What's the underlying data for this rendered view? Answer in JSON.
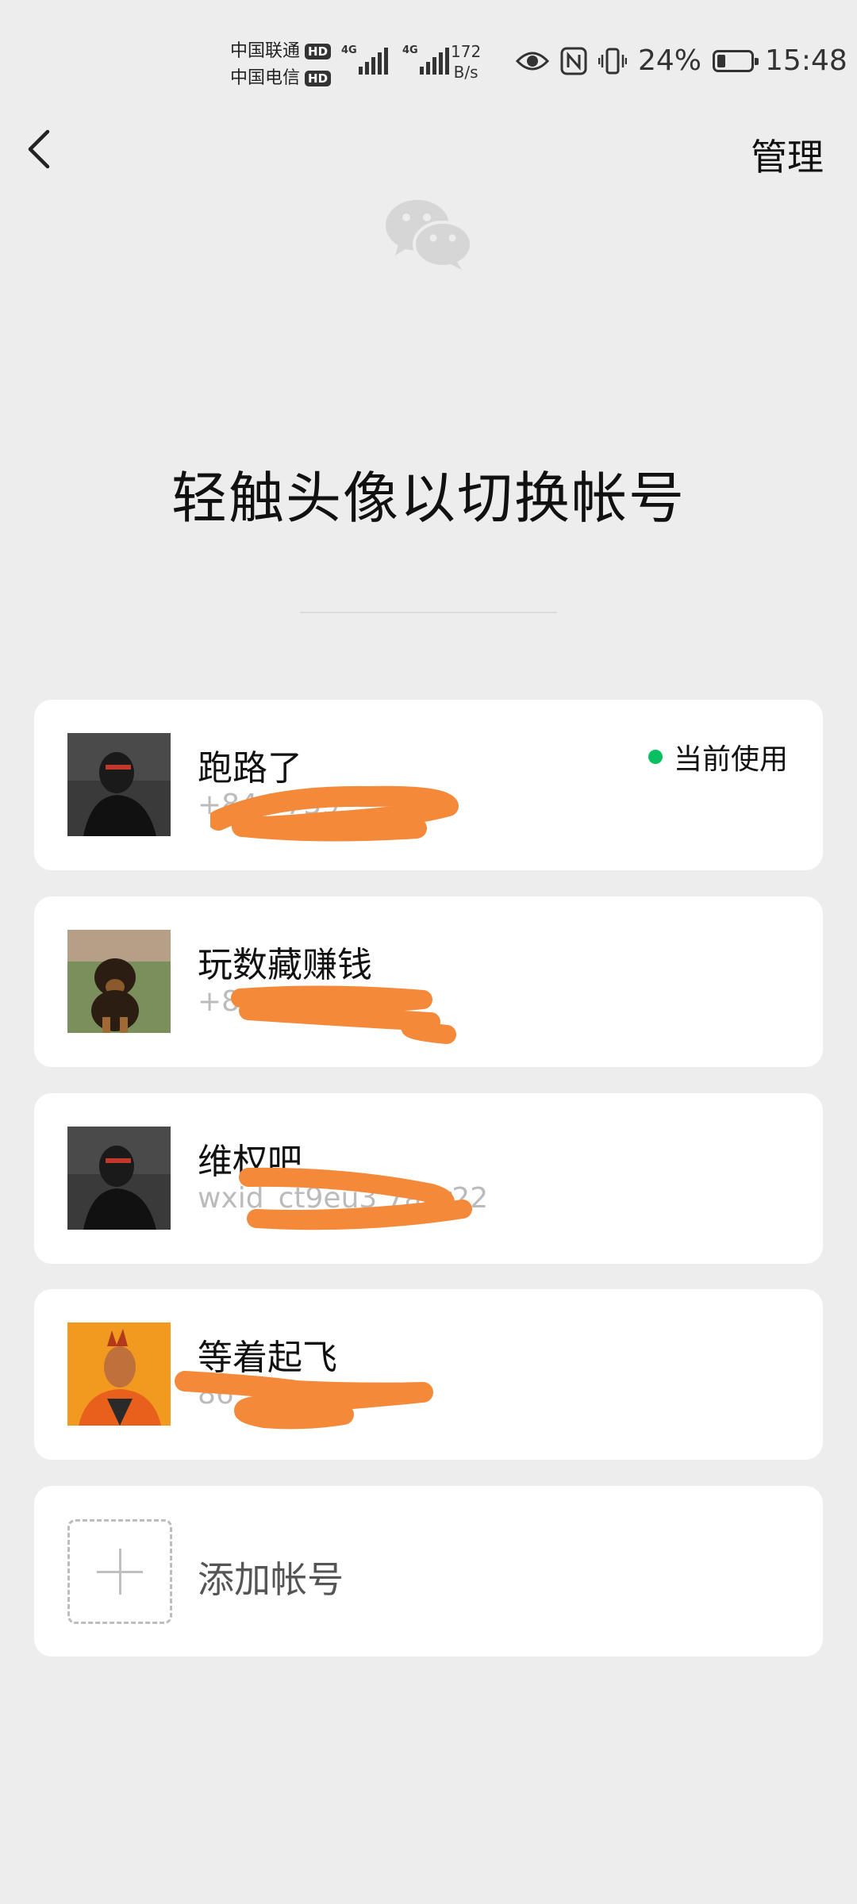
{
  "status_bar": {
    "carrier_1": "中国联通",
    "carrier_2": "中国电信",
    "hd_badge": "HD",
    "network_tag": "4G",
    "net_speed_value": "172",
    "net_speed_unit": "B/s",
    "battery_percent": "24%",
    "battery_level": 0.24,
    "time": "15:48"
  },
  "header": {
    "manage_label": "管理"
  },
  "page_title": "轻触头像以切换帐号",
  "accounts": [
    {
      "name": "跑路了",
      "id_visible": "+84                  7739",
      "current_label": "当前使用",
      "avatar": "dark-figure-avatar"
    },
    {
      "name": "玩数藏赚钱",
      "id_visible": "+8                    78986",
      "avatar": "puppy-avatar"
    },
    {
      "name": "维权吧",
      "id_visible": "wxid_ct9eu3        7anr22",
      "avatar": "dark-figure-avatar"
    },
    {
      "name": "等着起飞",
      "id_visible": "          86",
      "avatar": "orange-figure-avatar"
    }
  ],
  "add_account": {
    "label": "添加帐号"
  },
  "colors": {
    "background": "#ededed",
    "card": "#ffffff",
    "accent_green": "#07c160",
    "redaction_orange": "#f5893a"
  }
}
